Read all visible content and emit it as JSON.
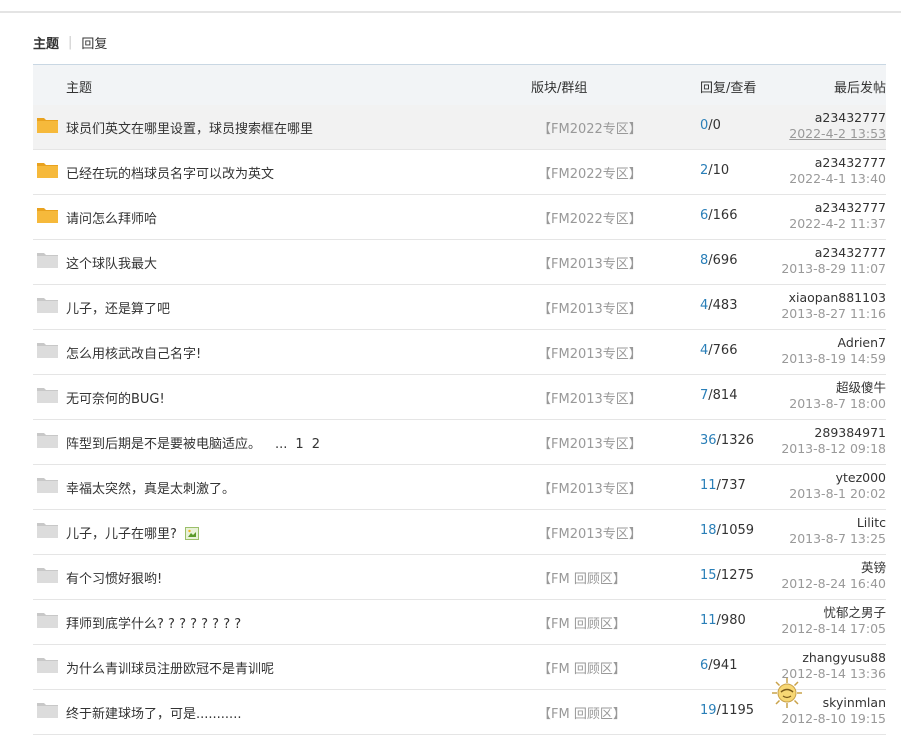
{
  "tabs": {
    "active": "主题",
    "separator": "|",
    "other": "回复"
  },
  "table": {
    "headers": {
      "subject": "主题",
      "forum": "版块/群组",
      "stats": "回复/查看",
      "last": "最后发帖"
    },
    "rows": [
      {
        "subject": "球员们英文在哪里设置，球员搜索框在哪里",
        "forum": "【FM2022专区】",
        "replies": "0",
        "views": "/0",
        "author": "a23432777",
        "date": "2022-4-2 13:53",
        "folder": "new",
        "hover": true
      },
      {
        "subject": "已经在玩的档球员名字可以改为英文",
        "forum": "【FM2022专区】",
        "replies": "2",
        "views": "/10",
        "author": "a23432777",
        "date": "2022-4-1 13:40",
        "folder": "new"
      },
      {
        "subject": "请问怎么拜师哈",
        "forum": "【FM2022专区】",
        "replies": "6",
        "views": "/166",
        "author": "a23432777",
        "date": "2022-4-2 11:37",
        "folder": "new"
      },
      {
        "subject": "这个球队我最大",
        "forum": "【FM2013专区】",
        "replies": "8",
        "views": "/696",
        "author": "a23432777",
        "date": "2013-8-29 11:07",
        "folder": "old"
      },
      {
        "subject": "儿子，还是算了吧",
        "forum": "【FM2013专区】",
        "replies": "4",
        "views": "/483",
        "author": "xiaopan881103",
        "date": "2013-8-27 11:16",
        "folder": "old"
      },
      {
        "subject": "怎么用核武改自己名字!",
        "forum": "【FM2013专区】",
        "replies": "4",
        "views": "/766",
        "author": "Adrien7",
        "date": "2013-8-19 14:59",
        "folder": "old"
      },
      {
        "subject": "无可奈何的BUG!",
        "forum": "【FM2013专区】",
        "replies": "7",
        "views": "/814",
        "author": "超级傻牛",
        "date": "2013-8-7 18:00",
        "folder": "old"
      },
      {
        "subject": "阵型到后期是不是要被电脑适应。",
        "forum": "【FM2013专区】",
        "replies": "36",
        "views": "/1326",
        "author": "289384971",
        "date": "2013-8-12 09:18",
        "folder": "old",
        "pages": [
          "...",
          "1",
          "2"
        ]
      },
      {
        "subject": "幸福太突然，真是太刺激了。",
        "forum": "【FM2013专区】",
        "replies": "11",
        "views": "/737",
        "author": "ytez000",
        "date": "2013-8-1 20:02",
        "folder": "old"
      },
      {
        "subject": "儿子，儿子在哪里?",
        "forum": "【FM2013专区】",
        "replies": "18",
        "views": "/1059",
        "author": "Lilitc",
        "date": "2013-8-7 13:25",
        "folder": "old",
        "attachment": "image-attachment-icon"
      },
      {
        "subject": "有个习惯好狠哟!",
        "forum": "【FM 回顾区】",
        "replies": "15",
        "views": "/1275",
        "author": "英镑",
        "date": "2012-8-24 16:40",
        "folder": "old"
      },
      {
        "subject": "拜师到底学什么? ? ? ? ? ? ? ?",
        "forum": "【FM 回顾区】",
        "replies": "11",
        "views": "/980",
        "author": "忧郁之男子",
        "date": "2012-8-14 17:05",
        "folder": "old"
      },
      {
        "subject": "为什么青训球员注册欧冠不是青训呢",
        "forum": "【FM 回顾区】",
        "replies": "6",
        "views": "/941",
        "author": "zhangyusu88",
        "date": "2012-8-14 13:36",
        "folder": "old"
      },
      {
        "subject": "终于新建球场了，可是...........",
        "forum": "【FM 回顾区】",
        "replies": "19",
        "views": "/1195",
        "author": "skyinmlan",
        "date": "2012-8-10 19:15",
        "folder": "old"
      }
    ]
  },
  "colors": {
    "accent": "#2a7fb8",
    "folder_new": "#f6b93b",
    "folder_old": "#dcdcdc",
    "header_bg": "#f2f4f6",
    "muted": "#999999"
  },
  "icons": {
    "new_folder": "folder-new-icon",
    "old_folder": "folder-icon",
    "mascot": "sun-mascot-icon"
  }
}
